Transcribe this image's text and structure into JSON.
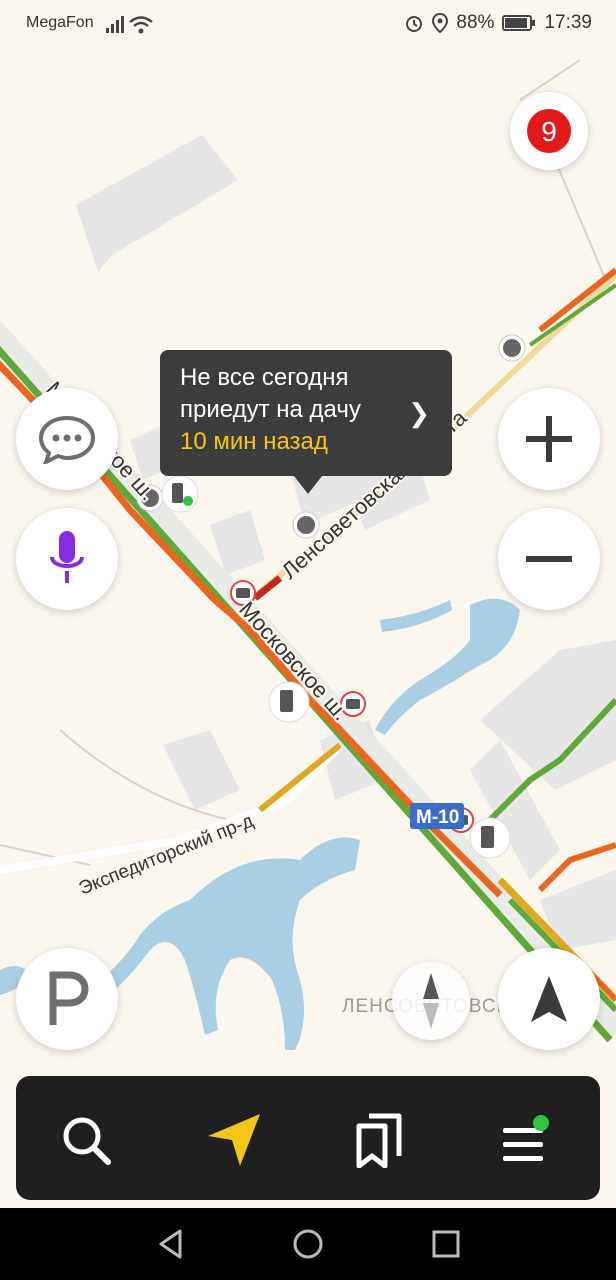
{
  "status_bar": {
    "carrier": "MegaFon",
    "battery": "88%",
    "time": "17:39",
    "icons": [
      "signal-icon",
      "wifi-icon",
      "alarm-icon",
      "location-icon",
      "battery-icon"
    ]
  },
  "map": {
    "road_labels": {
      "moskovskoe_upper": "Московское ш.",
      "moskovskoe_lower": "Московское ш.",
      "lensovetovskaya": "Ленсоветовская дорога",
      "ekspeditorsky": "Экспедиторский пр-д",
      "district": "ЛЕНСОВЕТОВСКИЙ",
      "route_shield": "М-10"
    },
    "traffic_score": "9",
    "colors": {
      "background": "#fbf7ef",
      "water": "#a8cfe3",
      "buildings": "#e7e7e7",
      "traffic_green": "#5fa83a",
      "traffic_orange": "#e8661f",
      "traffic_red": "#c0281f",
      "traffic_yellow": "#e0a820",
      "shield_blue": "#3b6cc7"
    }
  },
  "popup": {
    "title": "Не все сегодня приедут на дачу",
    "subtitle": "10 мин назад"
  },
  "controls": {
    "left": [
      "chat-bubble-icon",
      "microphone-icon",
      "parking-icon"
    ],
    "right": [
      "zoom-in-icon",
      "zoom-out-icon",
      "my-location-arrow-icon"
    ],
    "compass": "compass-icon"
  },
  "navbar": {
    "items": [
      "search-icon",
      "navigator-arrow-icon",
      "bookmarks-icon",
      "menu-icon"
    ]
  },
  "system_nav": [
    "back-icon",
    "home-icon",
    "recents-icon"
  ]
}
